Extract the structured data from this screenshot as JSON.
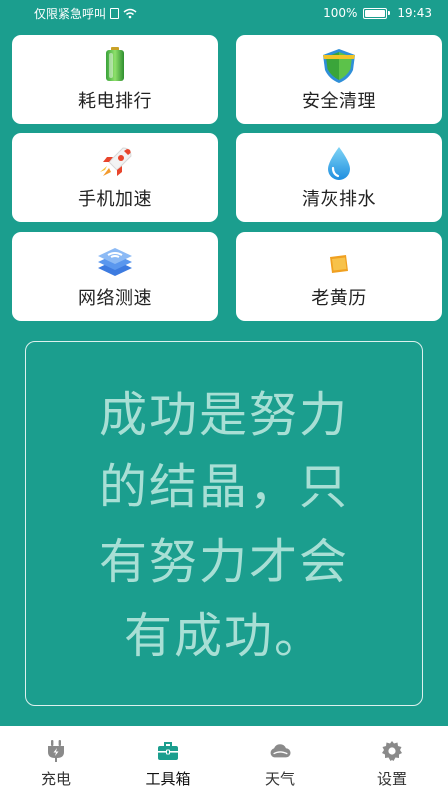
{
  "status_bar": {
    "carrier_text": "仅限紧急呼叫",
    "battery_percent": "100%",
    "time": "19:43"
  },
  "tools": [
    {
      "label": "耗电排行",
      "icon": "battery-icon"
    },
    {
      "label": "安全清理",
      "icon": "shield-icon"
    },
    {
      "label": "手机加速",
      "icon": "rocket-icon"
    },
    {
      "label": "清灰排水",
      "icon": "water-drop-icon"
    },
    {
      "label": "网络测速",
      "icon": "network-layers-icon"
    },
    {
      "label": "老黄历",
      "icon": "almanac-note-icon"
    }
  ],
  "quote": {
    "lines": [
      "成功是努力",
      "的结晶，只",
      "有努力才会",
      "有成功。"
    ],
    "color": "#a8dfd5"
  },
  "bottom_nav": [
    {
      "label": "充电",
      "icon": "charge-plug-icon",
      "active": false
    },
    {
      "label": "工具箱",
      "icon": "toolbox-icon",
      "active": true
    },
    {
      "label": "天气",
      "icon": "cloud-icon",
      "active": false
    },
    {
      "label": "设置",
      "icon": "gear-icon",
      "active": false
    }
  ],
  "colors": {
    "background": "#1b9e8e",
    "accent": "#1b9e8e",
    "nav_icon_inactive": "#8a8a8a"
  }
}
